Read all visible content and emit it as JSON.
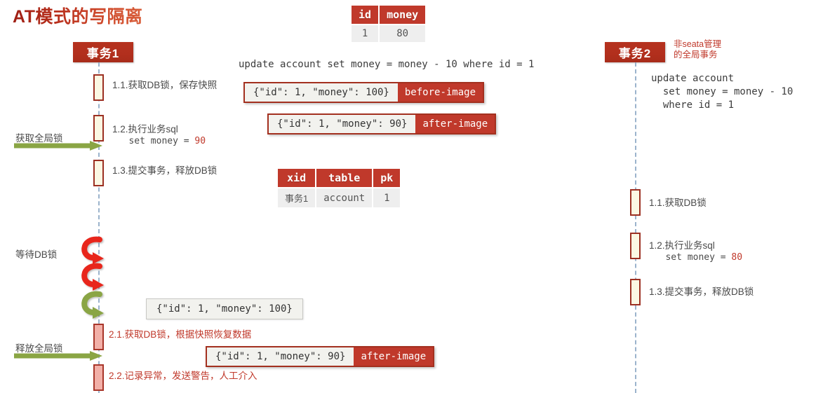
{
  "title": "AT模式的写隔离",
  "account_table": {
    "headers": [
      "id",
      "money"
    ],
    "rows": [
      [
        "1",
        "80"
      ]
    ]
  },
  "lock_table": {
    "headers": [
      "xid",
      "table",
      "pk"
    ],
    "rows": [
      [
        "事务1",
        "account",
        "1"
      ]
    ]
  },
  "tx1": {
    "actor_label": "事务1",
    "sql": "update account set money = money - 10 where id = 1",
    "steps": [
      {
        "text": "1.1.获取DB锁，保存快照"
      },
      {
        "text": "1.2.执行业务sql",
        "sub_prefix": "   set money = ",
        "sub_value": "90"
      },
      {
        "text": "1.3.提交事务，释放DB锁"
      },
      {
        "text": "2.1.获取DB锁，根据快照恢复数据"
      },
      {
        "text": "2.2.记录异常，发送警告，人工介入"
      }
    ]
  },
  "tx2": {
    "actor_label": "事务2",
    "note": "非seata管理\n的全局事务",
    "sql": "update account\n  set money = money - 10\n  where id = 1",
    "steps": [
      {
        "text": "1.1.获取DB锁"
      },
      {
        "text": "1.2.执行业务sql",
        "sub_prefix": "   set money = ",
        "sub_value": "80"
      },
      {
        "text": "1.3.提交事务，释放DB锁"
      }
    ]
  },
  "chips": {
    "before_image": {
      "json": "{\"id\": 1, \"money\": 100}",
      "tag": "before-image"
    },
    "after_image_1": {
      "json": "{\"id\": 1, \"money\": 90}",
      "tag": "after-image"
    },
    "snapshot_plain": {
      "json": "{\"id\": 1, \"money\": 100}"
    },
    "after_image_2": {
      "json": "{\"id\": 1, \"money\": 90}",
      "tag": "after-image"
    }
  },
  "arrows": {
    "acquire_global_lock": "获取全局锁",
    "wait_db_lock": "等待DB锁",
    "release_global_lock": "释放全局锁"
  },
  "colors": {
    "brand_red": "#c0392b",
    "dark_red": "#a3301f",
    "green": "#8aa544",
    "lifeline": "#9bb3cc",
    "activation_fill": "#fbf8e3",
    "activation_pink": "#f2b0a8"
  }
}
